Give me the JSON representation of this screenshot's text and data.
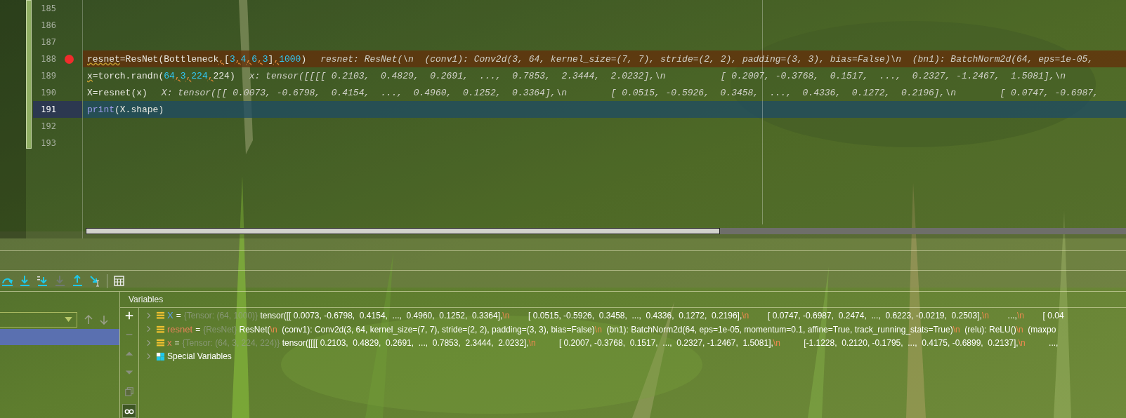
{
  "editor": {
    "lines": [
      {
        "number": "185",
        "breakpoint": false,
        "current": false
      },
      {
        "number": "186",
        "breakpoint": false,
        "current": false
      },
      {
        "number": "187",
        "breakpoint": false,
        "current": false
      },
      {
        "number": "188",
        "breakpoint": true,
        "current": false,
        "tokens": [
          {
            "text": "resnet",
            "kind": "warn"
          },
          {
            "text": "=ResNet(Bottleneck",
            "kind": "plain"
          },
          {
            "text": ",",
            "kind": "comma"
          },
          {
            "text": "[",
            "kind": "plain"
          },
          {
            "text": "3",
            "kind": "number"
          },
          {
            "text": ",",
            "kind": "comma"
          },
          {
            "text": "4",
            "kind": "number"
          },
          {
            "text": ",",
            "kind": "comma"
          },
          {
            "text": "6",
            "kind": "number"
          },
          {
            "text": ",",
            "kind": "comma"
          },
          {
            "text": "3",
            "kind": "number"
          },
          {
            "text": "]",
            "kind": "plain"
          },
          {
            "text": ",",
            "kind": "comma"
          },
          {
            "text": "1000",
            "kind": "number"
          },
          {
            "text": ")",
            "kind": "plain"
          }
        ],
        "hint": "resnet: ResNet(\\n  (conv1): Conv2d(3, 64, kernel_size=(7, 7), stride=(2, 2), padding=(3, 3), bias=False)\\n  (bn1): BatchNorm2d(64, eps=1e-05,"
      },
      {
        "number": "189",
        "breakpoint": false,
        "current": false,
        "tokens": [
          {
            "text": "x",
            "kind": "warn"
          },
          {
            "text": "=torch.randn(",
            "kind": "plain"
          },
          {
            "text": "64",
            "kind": "number"
          },
          {
            "text": ",",
            "kind": "comma"
          },
          {
            "text": "3",
            "kind": "number"
          },
          {
            "text": ",",
            "kind": "comma"
          },
          {
            "text": "224",
            "kind": "number"
          },
          {
            "text": ",",
            "kind": "comma"
          },
          {
            "text": "224)",
            "kind": "plain"
          }
        ],
        "hint": "x: tensor([[[[ 0.2103,  0.4829,  0.2691,  ...,  0.7853,  2.3444,  2.0232],\\n          [ 0.2007, -0.3768,  0.1517,  ...,  0.2327, -1.2467,  1.5081],\\n"
      },
      {
        "number": "190",
        "breakpoint": false,
        "current": false,
        "tokens": [
          {
            "text": "X=resnet(x)",
            "kind": "plain"
          }
        ],
        "hint": "X: tensor([[ 0.0073, -0.6798,  0.4154,  ...,  0.4960,  0.1252,  0.3364],\\n        [ 0.0515, -0.5926,  0.3458,  ...,  0.4336,  0.1272,  0.2196],\\n        [ 0.0747, -0.6987,"
      },
      {
        "number": "191",
        "breakpoint": false,
        "current": true,
        "tokens": [
          {
            "text": "print",
            "kind": "builtin"
          },
          {
            "text": "(X.shape)",
            "kind": "plain"
          }
        ]
      },
      {
        "number": "192",
        "breakpoint": false,
        "current": false
      },
      {
        "number": "193",
        "breakpoint": false,
        "current": false
      }
    ]
  },
  "frames": [
    {
      "selected": true
    }
  ],
  "variables": {
    "title": "Variables",
    "items": [
      {
        "kind": "value",
        "name": "X",
        "color": "#5b9ef0",
        "separator": "=",
        "type": "{Tensor: (64, 1000)}",
        "value": [
          {
            "text": "tensor([[ 0.0073, -0.6798,  0.4154,  ...,  0.4960,  0.1252,  0.3364],",
            "kind": "plain"
          },
          {
            "text": "\\n",
            "kind": "escape"
          },
          {
            "text": "        [ 0.0515, -0.5926,  0.3458,  ...,  0.4336,  0.1272,  0.2196],",
            "kind": "plain"
          },
          {
            "text": "\\n",
            "kind": "escape"
          },
          {
            "text": "        [ 0.0747, -0.6987,  0.2474,  ...,  0.6223, -0.0219,  0.2503],",
            "kind": "plain"
          },
          {
            "text": "\\n",
            "kind": "escape"
          },
          {
            "text": "        ...,",
            "kind": "plain"
          },
          {
            "text": "\\n",
            "kind": "escape"
          },
          {
            "text": "        [ 0.04",
            "kind": "plain"
          }
        ]
      },
      {
        "kind": "value",
        "name": "resnet",
        "color": "#e8825a",
        "separator": "=",
        "type": "{ResNet}",
        "value": [
          {
            "text": "ResNet(",
            "kind": "plain"
          },
          {
            "text": "\\n",
            "kind": "escape"
          },
          {
            "text": "  (conv1): Conv2d(3, 64, kernel_size=(7, 7), stride=(2, 2), padding=(3, 3), bias=False)",
            "kind": "plain"
          },
          {
            "text": "\\n",
            "kind": "escape"
          },
          {
            "text": "  (bn1): BatchNorm2d(64, eps=1e-05, momentum=0.1, affine=True, track_running_stats=True)",
            "kind": "plain"
          },
          {
            "text": "\\n",
            "kind": "escape"
          },
          {
            "text": "  (relu): ReLU()",
            "kind": "plain"
          },
          {
            "text": "\\n",
            "kind": "escape"
          },
          {
            "text": "  (maxpo",
            "kind": "plain"
          }
        ]
      },
      {
        "kind": "value",
        "name": "x",
        "color": "#e8825a",
        "separator": "=",
        "type": "{Tensor: (64, 3, 224, 224)}",
        "value": [
          {
            "text": "tensor([[[[ 0.2103,  0.4829,  0.2691,  ...,  0.7853,  2.3444,  2.0232],",
            "kind": "plain"
          },
          {
            "text": "\\n",
            "kind": "escape"
          },
          {
            "text": "          [ 0.2007, -0.3768,  0.1517,  ...,  0.2327, -1.2467,  1.5081],",
            "kind": "plain"
          },
          {
            "text": "\\n",
            "kind": "escape"
          },
          {
            "text": "          [-1.1228,  0.2120, -0.1795,  ...,  0.4175, -0.6899,  0.2137],",
            "kind": "plain"
          },
          {
            "text": "\\n",
            "kind": "escape"
          },
          {
            "text": "          ...,",
            "kind": "plain"
          }
        ]
      },
      {
        "kind": "special",
        "name": "Special Variables"
      }
    ]
  }
}
